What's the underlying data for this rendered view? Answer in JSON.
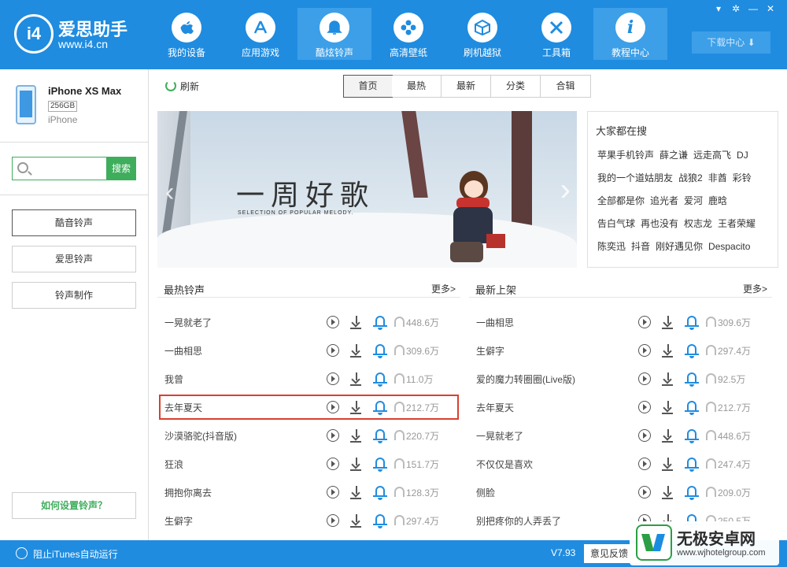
{
  "app": {
    "name": "爱思助手",
    "url": "www.i4.cn",
    "logo_mark": "i4"
  },
  "window_controls": [
    "shirt-icon",
    "gear-icon",
    "minimize-icon",
    "close-icon"
  ],
  "nav": [
    {
      "label": "我的设备",
      "icon": "apple-icon",
      "glyph": ""
    },
    {
      "label": "应用游戏",
      "icon": "appstore-icon",
      "glyph": "A"
    },
    {
      "label": "酷炫铃声",
      "icon": "bell-icon",
      "glyph": "🔔",
      "active": true
    },
    {
      "label": "高清壁纸",
      "icon": "flower-icon",
      "glyph": "✿"
    },
    {
      "label": "刷机越狱",
      "icon": "box-icon",
      "glyph": "⬡"
    },
    {
      "label": "工具箱",
      "icon": "tools-icon",
      "glyph": "✕"
    },
    {
      "label": "教程中心",
      "icon": "info-icon",
      "glyph": "i"
    }
  ],
  "download_center": "下载中心",
  "device": {
    "name": "iPhone XS Max",
    "storage": "256GB",
    "type": "iPhone"
  },
  "search": {
    "placeholder": "",
    "button": "搜索"
  },
  "sidebar_buttons": [
    "酷音铃声",
    "爱思铃声",
    "铃声制作"
  ],
  "help_button": "如何设置铃声？",
  "refresh": "刷新",
  "tabs": [
    "首页",
    "最热",
    "最新",
    "分类",
    "合辑"
  ],
  "banner": {
    "title": "一周好歌",
    "subtitle": "SELECTION OF POPULAR MELODY."
  },
  "hot_search": {
    "title": "大家都在搜",
    "rows": [
      [
        "苹果手机铃声",
        "薛之谦",
        "远走高飞",
        "DJ"
      ],
      [
        "我的一个道姑朋友",
        "战狼2",
        "非酋",
        "彩铃"
      ],
      [
        "全部都是你",
        "追光者",
        "爱河",
        "鹿晗"
      ],
      [
        "告白气球",
        "再也没有",
        "权志龙",
        "王者荣耀"
      ],
      [
        "陈奕迅",
        "抖音",
        "刚好遇见你",
        "Despacito"
      ]
    ]
  },
  "hot_list": {
    "title": "最热铃声",
    "more": "更多>",
    "items": [
      {
        "name": "一晃就老了",
        "count": "448.6万"
      },
      {
        "name": "一曲相思",
        "count": "309.6万"
      },
      {
        "name": "我曾",
        "count": "11.0万"
      },
      {
        "name": "去年夏天",
        "count": "212.7万",
        "highlight": true
      },
      {
        "name": "沙漠骆驼(抖音版)",
        "count": "220.7万"
      },
      {
        "name": "狂浪",
        "count": "151.7万"
      },
      {
        "name": "拥抱你离去",
        "count": "128.3万"
      },
      {
        "name": "生僻字",
        "count": "297.4万"
      }
    ]
  },
  "new_list": {
    "title": "最新上架",
    "more": "更多>",
    "items": [
      {
        "name": "一曲相思",
        "count": "309.6万"
      },
      {
        "name": "生僻字",
        "count": "297.4万"
      },
      {
        "name": "爱的魔力转圈圈(Live版)",
        "count": "92.5万"
      },
      {
        "name": "去年夏天",
        "count": "212.7万"
      },
      {
        "name": "一晃就老了",
        "count": "448.6万"
      },
      {
        "name": "不仅仅是喜欢",
        "count": "247.4万"
      },
      {
        "name": "侧脸",
        "count": "209.0万"
      },
      {
        "name": "别把疼你的人弄丢了",
        "count": "250.5万"
      }
    ]
  },
  "footer": {
    "itunes": "阻止iTunes自动运行",
    "version": "V7.93",
    "feedback": "意见反馈"
  },
  "watermark": {
    "title": "无极安卓网",
    "url": "www.wjhotelgroup.com"
  }
}
